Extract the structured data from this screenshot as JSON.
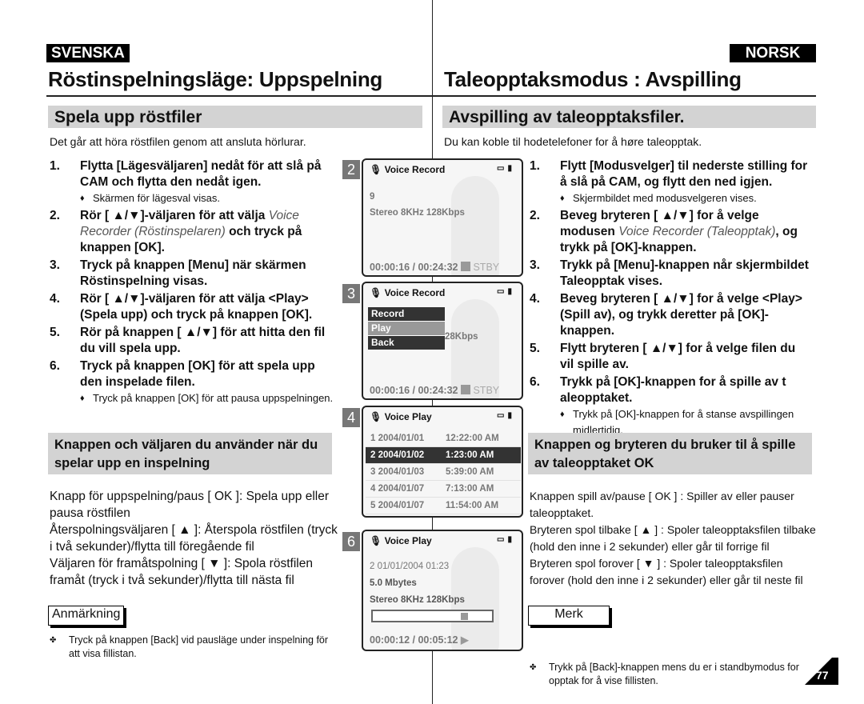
{
  "header": {
    "lang_left": "SVENSKA",
    "lang_right": "NORSK",
    "title_left": "Röstinspelningsläge: Uppspelning",
    "title_right": "Taleopptaksmodus : Avspilling"
  },
  "left": {
    "section": "Spela upp röstfiler",
    "intro": "Det går att höra röstfilen genom att ansluta hörlurar.",
    "steps": [
      {
        "n": "1.",
        "text": "Flytta [Lägesväljaren] nedåt för att slå på CAM och flytta den nedåt igen.",
        "sub": "Skärmen för lägesval visas."
      },
      {
        "n": "2.",
        "pre": "Rör [ ▲/▼]-väljaren för att välja ",
        "em": "Voice Recorder  (Röstinspelaren)",
        "post": " och tryck på knappen [OK]."
      },
      {
        "n": "3.",
        "text": "Tryck på knappen [Menu] när skärmen Röstinspelning visas."
      },
      {
        "n": "4.",
        "text": "Rör [ ▲/▼]-väljaren för att välja <Play> (Spela upp) och tryck på knappen [OK]."
      },
      {
        "n": "5.",
        "text": "Rör på knappen [ ▲/▼] för att hitta den fil du vill spela upp."
      },
      {
        "n": "6.",
        "text": "Tryck på knappen [OK] för att spela upp den inspelade filen.",
        "sub": "Tryck på knappen [OK] för att pausa uppspelningen."
      }
    ],
    "box_title": "Knappen och väljaren du använder när du spelar upp en inspelning",
    "body": [
      "Knapp för uppspelning/paus [ OK  ]: Spela upp eller pausa röstfilen",
      "Återspolningsväljaren [ ▲ ]: Återspola röstfilen (tryck i två sekunder)/flytta till föregående fil",
      "Väljaren för framåtspolning [ ▼ ]: Spola röstfilen framåt (tryck i två sekunder)/flytta till nästa fil"
    ],
    "note_label": "Anmärkning",
    "note": "Tryck på knappen [Back] vid pausläge under inspelning för att visa fillistan."
  },
  "right": {
    "section": "Avspilling av taleopptaksfiler.",
    "intro": "Du kan koble til hodetelefoner for å høre taleopptak.",
    "steps": [
      {
        "n": "1.",
        "text": "Flytt [Modusvelger] til nederste stilling for å slå på CAM, og flytt den ned igjen.",
        "sub": "Skjermbildet med modusvelgeren vises."
      },
      {
        "n": "2.",
        "pre": "Beveg bryteren [ ▲/▼] for å velge modusen ",
        "em": "Voice Recorder (Taleopptak)",
        "post": ", og trykk på [OK]-knappen."
      },
      {
        "n": "3.",
        "text": "Trykk på [Menu]-knappen når skjermbildet Taleopptak vises."
      },
      {
        "n": "4.",
        "text": "Beveg bryteren [ ▲/▼] for å velge <Play> (Spill av), og trykk deretter på [OK]-knappen."
      },
      {
        "n": "5.",
        "text": "Flytt bryteren [ ▲/▼] for å velge filen du vil spille av."
      },
      {
        "n": "6.",
        "text": "Trykk på [OK]-knappen for å spille av t aleopptaket.",
        "sub": "Trykk på [OK]-knappen for å stanse avspillingen midlertidig."
      }
    ],
    "box_title": "Knappen og bryteren du bruker til å spille av taleopptaket OK",
    "body": [
      "Knappen spill av/pause [ OK  ] : Spiller av eller pauser taleopptaket.",
      "Bryteren spol tilbake [ ▲ ] : Spoler taleopptaksfilen tilbake (hold den inne i 2 sekunder) eller går til forrige fil",
      "Bryteren spol forover [ ▼ ] : Spoler taleopptaksfilen forover (hold den inne i 2 sekunder) eller går til neste fil"
    ],
    "note_label": "Merk",
    "note": "Trykk på [Back]-knappen mens du er i standbymodus for opptak for å vise fillisten."
  },
  "screens": {
    "s2": {
      "num": "2",
      "title": "Voice Record",
      "line1": "9",
      "line2": "Stereo  8KHz  128Kbps",
      "time": "00:00:16 / 00:24:32",
      "status": "STBY"
    },
    "s3": {
      "num": "3",
      "title": "Voice Record",
      "menu": [
        "Record",
        "Play",
        "Back"
      ],
      "selected": "Play",
      "partial": "28Kbps",
      "time": "00:00:16 / 00:24:32",
      "status": "STBY"
    },
    "s4": {
      "num": "4",
      "title": "Voice Play",
      "rows": [
        [
          "1",
          "2004/01/01",
          "12:22:00 AM"
        ],
        [
          "2",
          "2004/01/02",
          "1:23:00 AM"
        ],
        [
          "3",
          "2004/01/03",
          "5:39:00 AM"
        ],
        [
          "4",
          "2004/01/07",
          "7:13:00 AM"
        ],
        [
          "5",
          "2004/01/07",
          "11:54:00 AM"
        ]
      ],
      "selected_row": 2
    },
    "s6": {
      "num": "6",
      "title": "Voice Play",
      "line1": "2  01/01/2004  01:23",
      "line2": "5.0 Mbytes",
      "line3": "Stereo  8KHz  128Kbps",
      "progress": 0.8,
      "time": "00:00:12 / 00:05:12"
    }
  },
  "page_number": "77"
}
